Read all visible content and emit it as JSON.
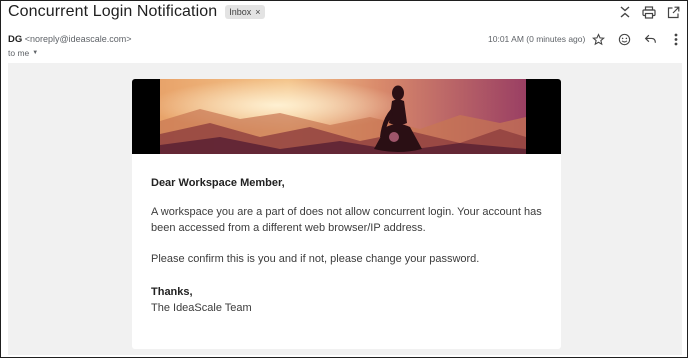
{
  "email": {
    "subject": "Concurrent Login Notification",
    "label": "Inbox",
    "label_close": "×",
    "sender_name": "DG",
    "sender_email": "<noreply@ideascale.com>",
    "recipient": "to me",
    "time": "10:01 AM (0 minutes ago)"
  },
  "message": {
    "greeting": "Dear Workspace Member,",
    "paragraph1": "A workspace you are a part of does not allow concurrent login. Your account has been accessed from a different web browser/IP address.",
    "paragraph2": "Please confirm this is you and if not, please change your password.",
    "signoff": "Thanks,",
    "signature": "The IdeaScale Team"
  },
  "icons": {
    "top": [
      "collapse-icon",
      "print-icon",
      "open-new-window-icon"
    ],
    "actions": [
      "star-icon",
      "emoji-icon",
      "reply-icon",
      "more-vert-icon"
    ]
  }
}
